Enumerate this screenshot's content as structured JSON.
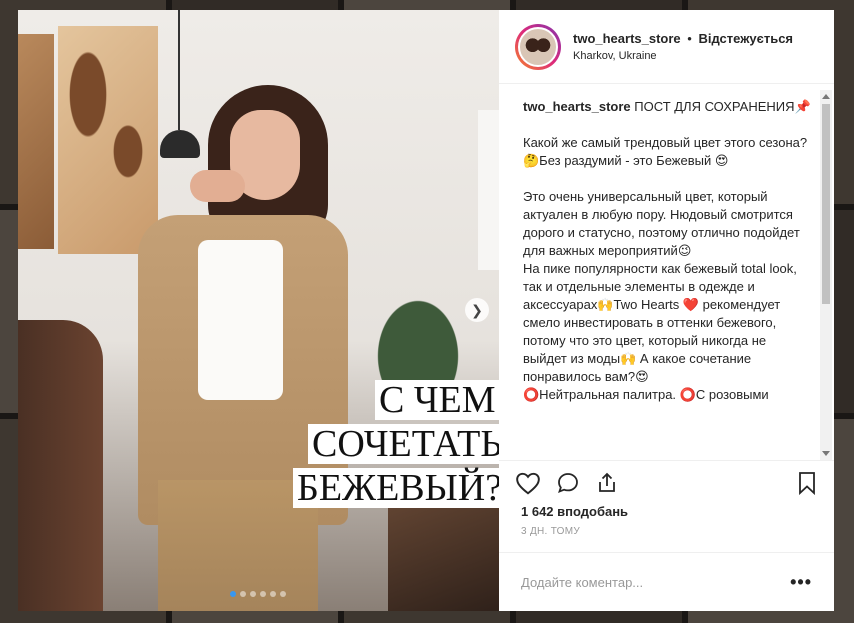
{
  "header": {
    "username": "two_hearts_store",
    "separator": "•",
    "follow_status": "Відстежується",
    "location": "Kharkov, Ukraine"
  },
  "photo": {
    "overlay_text": [
      "С ЧЕМ",
      "СОЧЕТАТЬ",
      "БЕЖЕВЫЙ?"
    ],
    "slide_count": 6,
    "active_slide": 1
  },
  "caption": {
    "username": "two_hearts_store",
    "paragraphs": [
      "ПОСТ ДЛЯ СОХРАНЕНИЯ📌",
      "Какой же самый трендовый цвет этого сезона?🤔Без раздумий - это Бежевый 😍",
      "Это очень универсальный цвет, который актуален в любую пору. Нюдовый смотрится дорого и статусно, поэтому отлично подойдет для важных мероприятий😉\nНа пике популярности как бежевый total look, так и отдельные элементы в одежде и аксессуарах🙌Two Hearts ❤️ рекомендует смело инвестировать в оттенки бежевого, потому что это цвет, который никогда не выйдет из моды🙌 А какое сочетание понравилось вам?😍\n⭕Нейтральная палитра. ⭕С розовыми"
    ]
  },
  "actions": {
    "like_icon": "heart-icon",
    "comment_icon": "comment-icon",
    "share_icon": "share-icon",
    "save_icon": "bookmark-icon"
  },
  "likes": "1 642 вподобань",
  "timestamp": "3 ДН. ТОМУ",
  "comment_input": {
    "placeholder": "Додайте коментар..."
  },
  "more_label": "•••"
}
